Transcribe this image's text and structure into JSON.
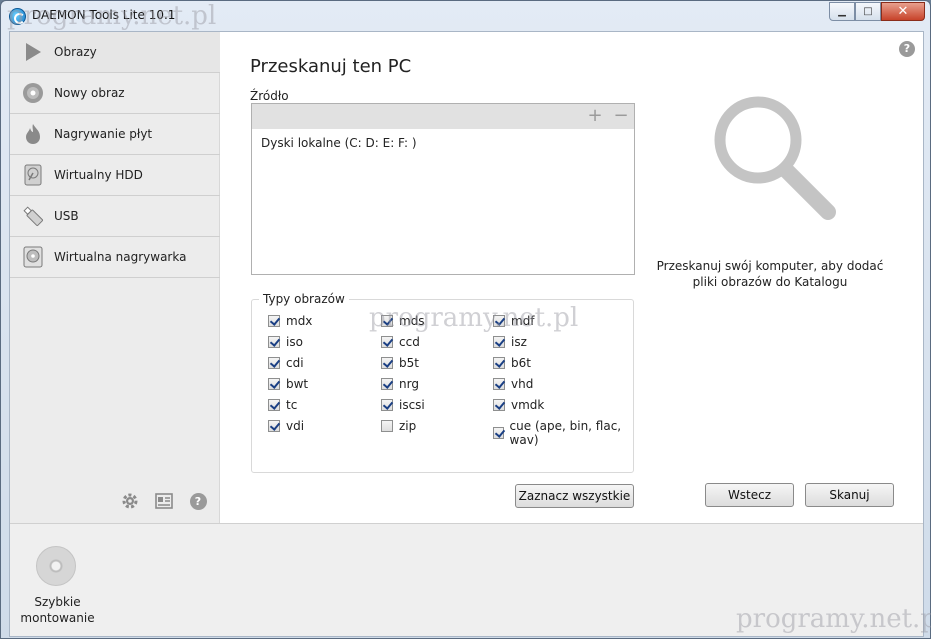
{
  "window": {
    "title": "DAEMON Tools Lite 10.1",
    "minimize": "▁",
    "maximize": "□",
    "close": "✕"
  },
  "sidebar": {
    "items": [
      {
        "label": "Obrazy",
        "icon": "play-icon"
      },
      {
        "label": "Nowy obraz",
        "icon": "disc-icon"
      },
      {
        "label": "Nagrywanie płyt",
        "icon": "flame-icon"
      },
      {
        "label": "Wirtualny HDD",
        "icon": "hdd-icon"
      },
      {
        "label": "USB",
        "icon": "usb-icon"
      },
      {
        "label": "Wirtualna nagrywarka",
        "icon": "burner-icon"
      }
    ],
    "tools": [
      "settings-icon",
      "license-icon",
      "help-icon"
    ]
  },
  "main": {
    "title": "Przeskanuj ten PC",
    "source_label": "Źródło",
    "source_add": "+",
    "source_remove": "−",
    "source_rows": [
      "Dyski lokalne (C: D: E: F: )"
    ],
    "types_label": "Typy obrazów",
    "types": [
      {
        "label": "mdx",
        "checked": true
      },
      {
        "label": "mds",
        "checked": true
      },
      {
        "label": "mdf",
        "checked": true
      },
      {
        "label": "iso",
        "checked": true
      },
      {
        "label": "ccd",
        "checked": true
      },
      {
        "label": "isz",
        "checked": true
      },
      {
        "label": "cdi",
        "checked": true
      },
      {
        "label": "b5t",
        "checked": true
      },
      {
        "label": "b6t",
        "checked": true
      },
      {
        "label": "bwt",
        "checked": true
      },
      {
        "label": "nrg",
        "checked": true
      },
      {
        "label": "vhd",
        "checked": true
      },
      {
        "label": "tc",
        "checked": true
      },
      {
        "label": "iscsi",
        "checked": true
      },
      {
        "label": "vmdk",
        "checked": true
      },
      {
        "label": "vdi",
        "checked": true
      },
      {
        "label": "zip",
        "checked": false
      },
      {
        "label": "cue (ape, bin, flac, wav)",
        "checked": true
      }
    ],
    "select_all_button": "Zaznacz wszystkie",
    "hint": "Przeskanuj swój komputer, aby dodać pliki obrazów do Katalogu",
    "back_button": "Wstecz",
    "scan_button": "Skanuj",
    "help": "?"
  },
  "bottom": {
    "quick_mount_label": "Szybkie montowanie"
  },
  "watermarks": [
    "programy.net.pl",
    "programy.net.pl",
    "programy.net.pl"
  ]
}
